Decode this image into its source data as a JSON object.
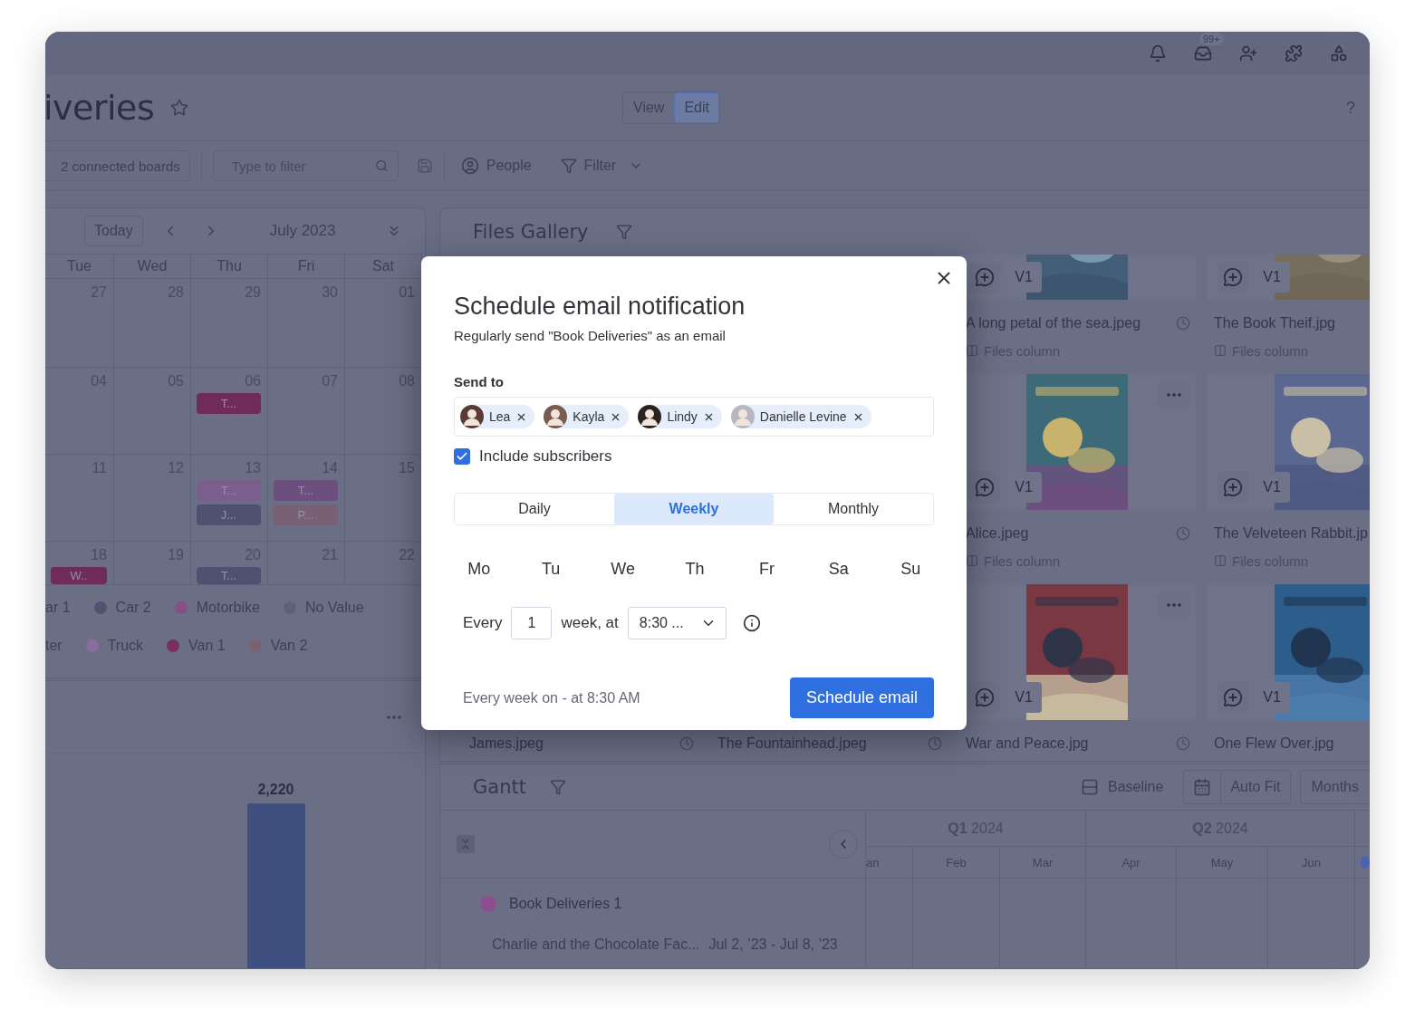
{
  "topbar": {
    "inbox_badge": "99+"
  },
  "board": {
    "title": "iveries",
    "modes": [
      {
        "label": "View",
        "selected": false
      },
      {
        "label": "Edit",
        "selected": true
      }
    ],
    "help": "?"
  },
  "toolbar": {
    "connected_boards": "2 connected boards",
    "filter_placeholder": "Type to filter",
    "people": "People",
    "filter": "Filter"
  },
  "calendar": {
    "today": "Today",
    "month": "July 2023",
    "weekdays": [
      "Tue",
      "Wed",
      "Thu",
      "Fri",
      "Sat"
    ],
    "weeks": [
      {
        "days": [
          {
            "date": "27"
          },
          {
            "date": "28"
          },
          {
            "date": "29"
          },
          {
            "date": "30"
          },
          {
            "date": "01"
          }
        ]
      },
      {
        "days": [
          {
            "date": "04"
          },
          {
            "date": "05"
          },
          {
            "date": "06",
            "events": [
              {
                "label": "T...",
                "color": "#6e2b5c"
              }
            ]
          },
          {
            "date": "07"
          },
          {
            "date": "08"
          }
        ]
      },
      {
        "days": [
          {
            "date": "11"
          },
          {
            "date": "12"
          },
          {
            "date": "13",
            "events": [
              {
                "label": "T...",
                "color": "#7a5f8e"
              },
              {
                "label": "J...",
                "color": "#4e5270"
              }
            ]
          },
          {
            "date": "14",
            "events": [
              {
                "label": "T...",
                "color": "#6c4f7e"
              },
              {
                "label": "P...",
                "color": "#7a6075"
              }
            ]
          },
          {
            "date": "15"
          }
        ]
      },
      {
        "days": [
          {
            "date": "18",
            "events": [
              {
                "label": "W..",
                "color": "#6e2b5c"
              }
            ]
          },
          {
            "date": "19"
          },
          {
            "date": "20",
            "events": [
              {
                "label": "T...",
                "color": "#4e5270"
              }
            ]
          },
          {
            "date": "21"
          },
          {
            "date": "22"
          }
        ]
      }
    ],
    "legend": [
      [
        {
          "label": "ar 1"
        },
        {
          "label": "Car 2",
          "color": "#4f5373"
        },
        {
          "label": "Motorbike",
          "color": "#864f86"
        },
        {
          "label": "No Value",
          "color": "#5f6277"
        }
      ],
      [
        {
          "label": "ter"
        },
        {
          "label": "Truck",
          "color": "#8b6d9d"
        },
        {
          "label": "Van 1",
          "color": "#7a2d5f"
        },
        {
          "label": "Van 2",
          "color": "#7c6173"
        }
      ]
    ]
  },
  "chart": {
    "bar_label": "2,220"
  },
  "gallery": {
    "title": "Files Gallery",
    "rows": [
      {
        "cards": [
          {
            "kind": "file",
            "name": "A long petal of the sea.jpeg",
            "version": "V1",
            "column_label": "Files column",
            "menu": false
          },
          {
            "kind": "file",
            "name": "The Book Theif.jpg",
            "version": "V1",
            "column_label": "Files column",
            "menu": false
          }
        ]
      },
      {
        "cards": [
          {
            "kind": "file",
            "name": "Alice.jpeg",
            "version": "V1",
            "column_label": "Files column",
            "menu": true
          },
          {
            "kind": "file",
            "name": "The Velveteen Rabbit.jp",
            "version": "V1",
            "column_label": "Files column",
            "menu": false
          }
        ]
      },
      {
        "cards": [
          {
            "kind": "covered",
            "name": "James.jpeg"
          },
          {
            "kind": "covered",
            "name": "The Fountainhead.jpeg"
          },
          {
            "kind": "file",
            "name": "War and Peace.jpg",
            "version": "V1",
            "menu": true
          },
          {
            "kind": "file",
            "name": "One Flew Over.jpg",
            "version": "V1",
            "menu": false
          }
        ]
      }
    ]
  },
  "gantt": {
    "title": "Gantt",
    "baseline": "Baseline",
    "auto_fit": "Auto Fit",
    "months_button": "Months",
    "quarters": [
      "**Q1** 2024",
      "**Q2** 2024"
    ],
    "months": [
      "an",
      "Feb",
      "Mar",
      "Apr",
      "May",
      "Jun"
    ],
    "group": {
      "name": "Book Deliveries 1",
      "color": "#8a4f8c"
    },
    "items": [
      {
        "name": "Charlie and the Chocolate Fac...",
        "dates": "Jul 2, ’23 - Jul 8, ’23"
      }
    ]
  },
  "modal": {
    "title": "Schedule email notification",
    "subtitle": "Regularly send \"Book Deliveries\" as an email",
    "send_to_label": "Send to",
    "recipients": [
      {
        "name": "Lea"
      },
      {
        "name": "Kayla"
      },
      {
        "name": "Lindy"
      },
      {
        "name": "Danielle Levine"
      }
    ],
    "include_subscribers": {
      "label": "Include subscribers",
      "checked": true
    },
    "frequency": [
      {
        "label": "Daily",
        "selected": false
      },
      {
        "label": "Weekly",
        "selected": true
      },
      {
        "label": "Monthly",
        "selected": false
      }
    ],
    "days": [
      {
        "label": "Mo",
        "selected": false
      },
      {
        "label": "Tu",
        "selected": false
      },
      {
        "label": "We",
        "selected": false
      },
      {
        "label": "Th",
        "selected": false
      },
      {
        "label": "Fr",
        "selected": false
      },
      {
        "label": "Sa",
        "selected": false
      },
      {
        "label": "Su",
        "selected": false
      }
    ],
    "every_label": "Every",
    "interval": "1",
    "unit_label": "week, at",
    "time": "8:30 ...",
    "summary": "Every week on - at 8:30 AM",
    "submit": "Schedule email"
  }
}
